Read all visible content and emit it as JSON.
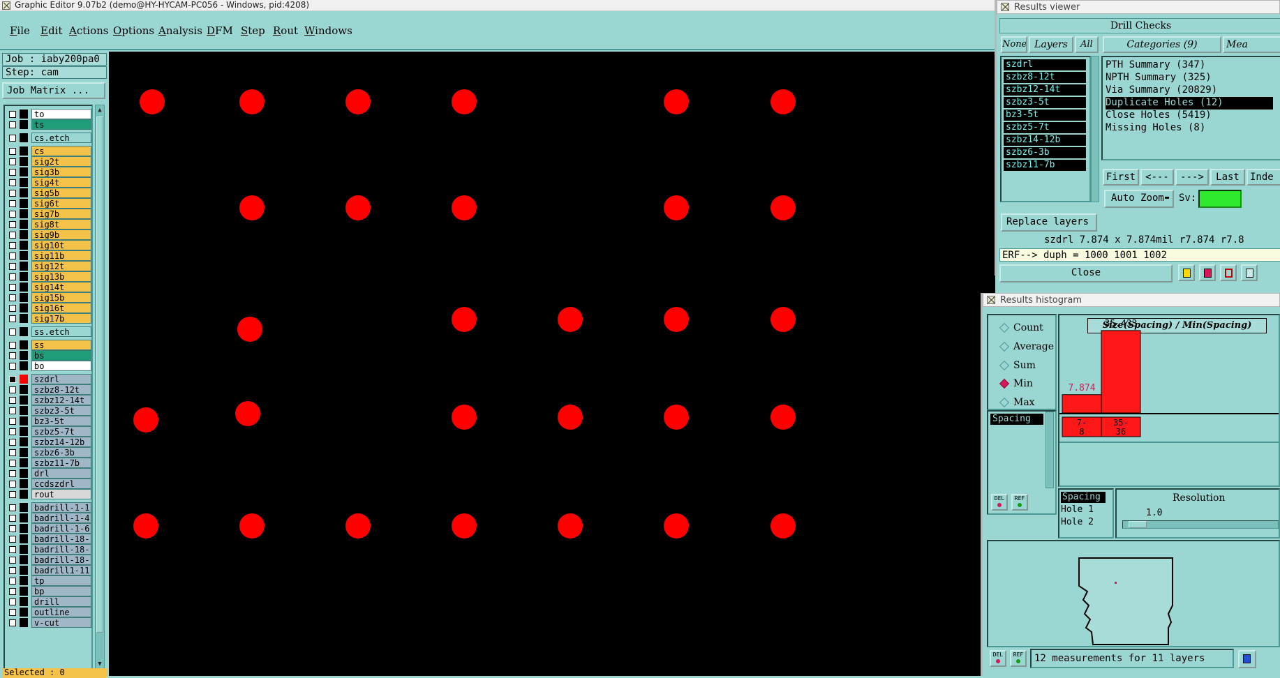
{
  "window": {
    "title": "Graphic Editor 9.07b2 (demo@HY-HYCAM-PC056 - Windows, pid:4208)"
  },
  "menu": [
    "File",
    "Edit",
    "Actions",
    "Options",
    "Analysis",
    "DFM",
    "Step",
    "Rout",
    "Windows"
  ],
  "left_panel": {
    "job": "Job : iaby200pa0",
    "step": "Step: cam",
    "job_matrix": "Job Matrix ...",
    "selected": "Selected : 0",
    "layers": [
      {
        "name": "to",
        "bg": "#ffffff",
        "checked": false
      },
      {
        "name": "ts",
        "bg": "#1f9c78",
        "checked": false
      },
      {
        "name": "cs.etch",
        "bg": "#9ad6d2",
        "checked": false
      },
      {
        "name": "cs",
        "bg": "#f5c249",
        "checked": false
      },
      {
        "name": "sig2t",
        "bg": "#f5c249",
        "checked": false
      },
      {
        "name": "sig3b",
        "bg": "#f5c249",
        "checked": false
      },
      {
        "name": "sig4t",
        "bg": "#f5c249",
        "checked": false
      },
      {
        "name": "sig5b",
        "bg": "#f5c249",
        "checked": false
      },
      {
        "name": "sig6t",
        "bg": "#f5c249",
        "checked": false
      },
      {
        "name": "sig7b",
        "bg": "#f5c249",
        "checked": false
      },
      {
        "name": "sig8t",
        "bg": "#f5c249",
        "checked": false
      },
      {
        "name": "sig9b",
        "bg": "#f5c249",
        "checked": false
      },
      {
        "name": "sig10t",
        "bg": "#f5c249",
        "checked": false
      },
      {
        "name": "sig11b",
        "bg": "#f5c249",
        "checked": false
      },
      {
        "name": "sig12t",
        "bg": "#f5c249",
        "checked": false
      },
      {
        "name": "sig13b",
        "bg": "#f5c249",
        "checked": false
      },
      {
        "name": "sig14t",
        "bg": "#f5c249",
        "checked": false
      },
      {
        "name": "sig15b",
        "bg": "#f5c249",
        "checked": false
      },
      {
        "name": "sig16t",
        "bg": "#f5c249",
        "checked": false
      },
      {
        "name": "sig17b",
        "bg": "#f5c249",
        "checked": false
      },
      {
        "name": "ss.etch",
        "bg": "#9ad6d2",
        "checked": false
      },
      {
        "name": "ss",
        "bg": "#f5c249",
        "checked": false
      },
      {
        "name": "bs",
        "bg": "#1f9c78",
        "checked": false
      },
      {
        "name": "bo",
        "bg": "#ffffff",
        "checked": false
      },
      {
        "name": "szdrl",
        "bg": "#9fb7c7",
        "checked": true
      },
      {
        "name": "szbz8-12t",
        "bg": "#9fb7c7",
        "checked": false
      },
      {
        "name": "szbz12-14t",
        "bg": "#9fb7c7",
        "checked": false
      },
      {
        "name": "szbz3-5t",
        "bg": "#9fb7c7",
        "checked": false
      },
      {
        "name": "bz3-5t",
        "bg": "#9fb7c7",
        "checked": false
      },
      {
        "name": "szbz5-7t",
        "bg": "#9fb7c7",
        "checked": false
      },
      {
        "name": "szbz14-12b",
        "bg": "#9fb7c7",
        "checked": false
      },
      {
        "name": "szbz6-3b",
        "bg": "#9fb7c7",
        "checked": false
      },
      {
        "name": "szbz11-7b",
        "bg": "#9fb7c7",
        "checked": false
      },
      {
        "name": "drl",
        "bg": "#9fb7c7",
        "checked": false
      },
      {
        "name": "ccdszdrl",
        "bg": "#9fb7c7",
        "checked": false
      },
      {
        "name": "rout",
        "bg": "#d8d8d8",
        "checked": false
      },
      {
        "name": "badrill-1-1",
        "bg": "#9fb7c7",
        "checked": false
      },
      {
        "name": "badrill-1-4",
        "bg": "#9fb7c7",
        "checked": false
      },
      {
        "name": "badrill-1-6",
        "bg": "#9fb7c7",
        "checked": false
      },
      {
        "name": "badrill-18-",
        "bg": "#9fb7c7",
        "checked": false
      },
      {
        "name": "badrill-18-",
        "bg": "#9fb7c7",
        "checked": false
      },
      {
        "name": "badrill-18-",
        "bg": "#9fb7c7",
        "checked": false
      },
      {
        "name": "badrill1-11",
        "bg": "#9fb7c7",
        "checked": false
      },
      {
        "name": "tp",
        "bg": "#9fb7c7",
        "checked": false
      },
      {
        "name": "bp",
        "bg": "#9fb7c7",
        "checked": false
      },
      {
        "name": "drill",
        "bg": "#9fb7c7",
        "checked": false
      },
      {
        "name": "outline",
        "bg": "#9fb7c7",
        "checked": false
      },
      {
        "name": "v-cut",
        "bg": "#9fb7c7",
        "checked": false
      }
    ]
  },
  "canvas": {
    "background": "#000000",
    "pad_color": "#ff0000"
  },
  "results_viewer": {
    "title": "Results viewer",
    "header": "Drill Checks",
    "none_btn": "None",
    "layers_btn": "Layers",
    "all_btn": "All",
    "categories_btn": "Categories (9)",
    "mea_btn": "Mea",
    "layers": [
      "szdrl",
      "szbz8-12t",
      "szbz12-14t",
      "szbz3-5t",
      "bz3-5t",
      "szbz5-7t",
      "szbz14-12b",
      "szbz6-3b",
      "szbz11-7b"
    ],
    "categories": [
      {
        "label": "PTH Summary (347)",
        "selected": false
      },
      {
        "label": "NPTH Summary (325)",
        "selected": false
      },
      {
        "label": "Via Summary (20829)",
        "selected": false
      },
      {
        "label": "Duplicate Holes (12)",
        "selected": true
      },
      {
        "label": "Close Holes (5419)",
        "selected": false
      },
      {
        "label": "Missing Holes (8)",
        "selected": false
      }
    ],
    "nav": {
      "first": "First",
      "prev": "<---",
      "next": "--->",
      "last": "Last",
      "index": "Inde"
    },
    "auto_zoom": "Auto Zoom",
    "sv_label": "Sv:",
    "replace_layers": "Replace layers",
    "status": "szdrl 7.874 x 7.874mil  r7.874  r7.8",
    "erf": "ERF--> duph = 1000 1001 1002",
    "close": "Close"
  },
  "histogram": {
    "title": "Results histogram",
    "modes": [
      {
        "label": "Count",
        "on": false
      },
      {
        "label": "Average",
        "on": false
      },
      {
        "label": "Sum",
        "on": false
      },
      {
        "label": "Min",
        "on": true
      },
      {
        "label": "Max",
        "on": false
      }
    ],
    "measure_list": [
      "Spacing"
    ],
    "chart_title": "Size(Spacing) / Min(Spacing)",
    "bins": [
      "7-\n8",
      "35-\n36"
    ],
    "values": [
      7.874,
      35.433
    ],
    "value_labels": [
      "7.874",
      "35.433"
    ],
    "x_fields": [
      "Spacing",
      "Hole 1",
      "Hole 2"
    ],
    "resolution_label": "Resolution",
    "resolution_value": "1.0",
    "footer": "12 measurements for 11 layers",
    "del": "DEL",
    "ref": "REF"
  }
}
